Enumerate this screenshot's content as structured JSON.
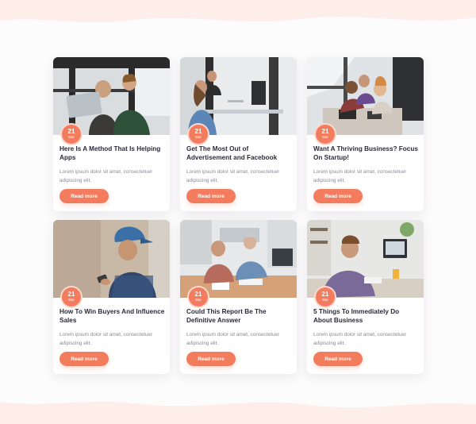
{
  "colors": {
    "accent": "#f47c5e",
    "title": "#2c2a3b",
    "muted": "#8a8a96"
  },
  "posts": [
    {
      "day": "21",
      "month": "Mar",
      "title": "Here Is A Method That Is Helping Apps",
      "excerpt": "Lorem ipsum dolor sit amet, consectetuer adipiscing elit.",
      "button": "Read more"
    },
    {
      "day": "21",
      "month": "Mar",
      "title": "Get The Most Out of Advertisement and Facebook",
      "excerpt": "Lorem ipsum dolor sit amet, consectetuer adipiscing elit.",
      "button": "Read more"
    },
    {
      "day": "21",
      "month": "Mar",
      "title": "Want A Thriving Business? Focus On Startup!",
      "excerpt": "Lorem ipsum dolor sit amet, consectetuer adipiscing elit.",
      "button": "Read more"
    },
    {
      "day": "21",
      "month": "Mar",
      "title": "How To Win Buyers And Influence Sales",
      "excerpt": "Lorem ipsum dolor sit amet, consectetuer adipiscing elit.",
      "button": "Read more"
    },
    {
      "day": "21",
      "month": "Mar",
      "title": "Could This Report Be The Definitive Answer",
      "excerpt": "Lorem ipsum dolor sit amet, consectetuer adipiscing elit.",
      "button": "Read more"
    },
    {
      "day": "21",
      "month": "Mar",
      "title": "5 Things To Immediately Do About Business",
      "excerpt": "Lorem ipsum dolor sit amet, consectetuer adipiscing elit.",
      "button": "Read more"
    }
  ]
}
